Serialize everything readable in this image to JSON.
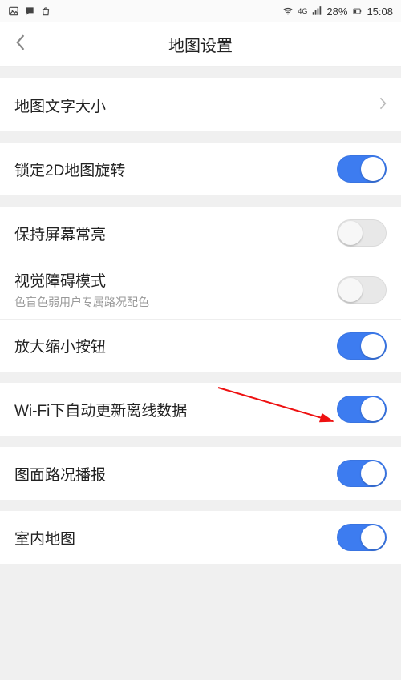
{
  "statusbar": {
    "battery_pct": "28%",
    "time": "15:08",
    "net_label": "4G"
  },
  "header": {
    "title": "地图设置"
  },
  "rows": {
    "text_size": {
      "label": "地图文字大小"
    },
    "lock_2d": {
      "label": "锁定2D地图旋转",
      "on": true
    },
    "screen_on": {
      "label": "保持屏幕常亮",
      "on": false
    },
    "colorblind": {
      "label": "视觉障碍模式",
      "sub": "色盲色弱用户专属路况配色",
      "on": false
    },
    "zoom_btn": {
      "label": "放大缩小按钮",
      "on": true
    },
    "wifi_update": {
      "label": "Wi-Fi下自动更新离线数据",
      "on": true
    },
    "traffic_voice": {
      "label": "图面路况播报",
      "on": true
    },
    "indoor": {
      "label": "室内地图",
      "on": true
    }
  }
}
